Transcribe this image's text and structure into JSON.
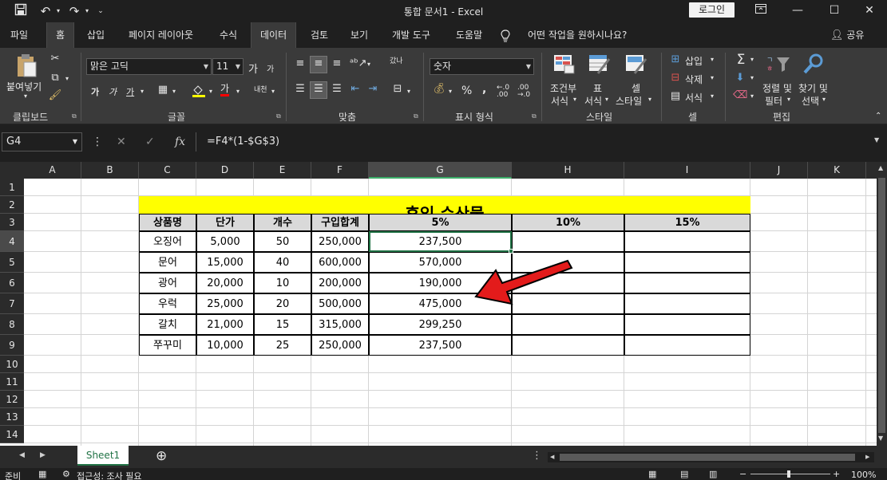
{
  "titlebar": {
    "title": "통합 문서1  -  Excel",
    "login": "로그인",
    "qat": [
      "save-icon",
      "undo-icon",
      "redo-icon",
      "customize-icon"
    ]
  },
  "tabs": [
    {
      "label": "파일"
    },
    {
      "label": "홈"
    },
    {
      "label": "삽입"
    },
    {
      "label": "페이지 레이아웃"
    },
    {
      "label": "수식"
    },
    {
      "label": "데이터"
    },
    {
      "label": "검토"
    },
    {
      "label": "보기"
    },
    {
      "label": "개발 도구"
    },
    {
      "label": "도움말"
    }
  ],
  "tell_me": "어떤 작업을 원하시나요?",
  "share": "공유",
  "ribbon": {
    "clipboard": {
      "paste": "붙여넣기",
      "label": "클립보드"
    },
    "font": {
      "name": "맑은 고딕",
      "size": "11",
      "grow": "가",
      "shrink": "가",
      "bold": "가",
      "italic": "가",
      "underline": "가",
      "color_a": "가",
      "phonetic": "내천",
      "label": "글꼴"
    },
    "alignment": {
      "wrap": "갔나",
      "label": "맞춤"
    },
    "number": {
      "format": "숫자",
      "percent": "%",
      "comma": ",",
      "label": "표시 형식"
    },
    "styles": {
      "conditional_1": "조건부",
      "conditional_2": "서식",
      "table_1": "표",
      "table_2": "서식",
      "cell_1": "셀",
      "cell_2": "스타일",
      "label": "스타일"
    },
    "cells": {
      "insert": "삽입",
      "delete": "삭제",
      "format": "서식",
      "label": "셀"
    },
    "editing": {
      "sort_1": "정렬 및",
      "sort_2": "필터",
      "find_1": "찾기 및",
      "find_2": "선택",
      "label": "편집"
    }
  },
  "formula_bar": {
    "name_box": "G4",
    "fx": "fx",
    "formula": "=F4*(1-$G$3)"
  },
  "columns": [
    "A",
    "B",
    "C",
    "D",
    "E",
    "F",
    "G",
    "H",
    "I",
    "J",
    "K"
  ],
  "rows": [
    "1",
    "2",
    "3",
    "4",
    "5",
    "6",
    "7",
    "8",
    "9",
    "10",
    "11",
    "12",
    "13",
    "14"
  ],
  "sheet": {
    "title": "휴잉 수산물",
    "headers": [
      "상품명",
      "단가",
      "개수",
      "구입합계",
      "5%",
      "10%",
      "15%"
    ],
    "data": [
      [
        "오징어",
        "5,000",
        "50",
        "250,000",
        "237,500"
      ],
      [
        "문어",
        "15,000",
        "40",
        "600,000",
        "570,000"
      ],
      [
        "광어",
        "20,000",
        "10",
        "200,000",
        "190,000"
      ],
      [
        "우럭",
        "25,000",
        "20",
        "500,000",
        "475,000"
      ],
      [
        "갈치",
        "21,000",
        "15",
        "315,000",
        "299,250"
      ],
      [
        "쭈꾸미",
        "10,000",
        "25",
        "250,000",
        "237,500"
      ]
    ],
    "title_fill": "#ffff00",
    "header_fill": "#d9d9d9",
    "arrow_color": "#e31b1b"
  },
  "sheet_tabs": [
    {
      "label": "Sheet1"
    }
  ],
  "status": {
    "ready": "준비",
    "accessibility": "접근성: 조사 필요",
    "zoom": "100%"
  }
}
